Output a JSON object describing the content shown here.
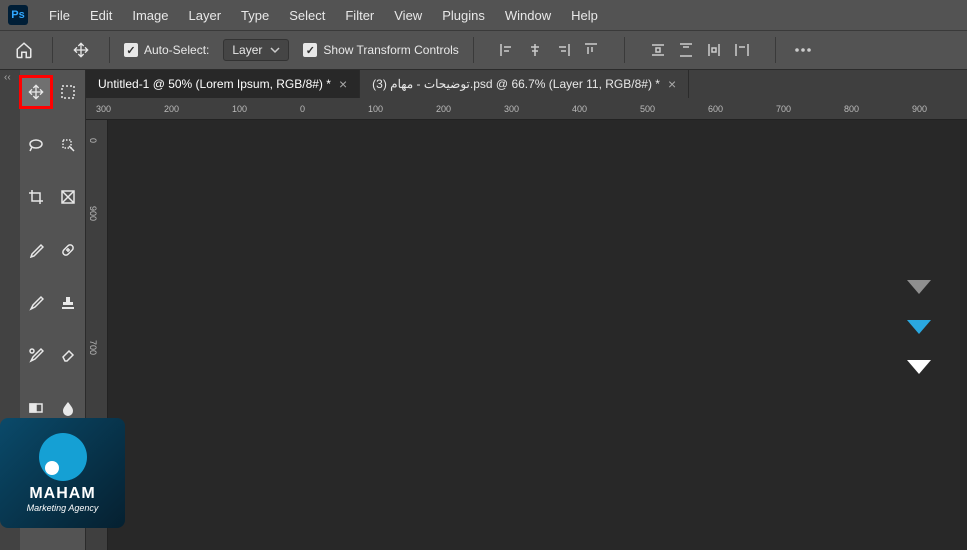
{
  "menubar": {
    "items": [
      "File",
      "Edit",
      "Image",
      "Layer",
      "Type",
      "Select",
      "Filter",
      "View",
      "Plugins",
      "Window",
      "Help"
    ]
  },
  "optbar": {
    "auto_select_label": "Auto-Select:",
    "layer_dd": "Layer",
    "show_transform_label": "Show Transform Controls"
  },
  "tabs": [
    {
      "label": "Untitled-1 @ 50% (Lorem Ipsum, RGB/8#) *",
      "active": true
    },
    {
      "label": "توضيحات - مهام (3).psd @ 66.7% (Layer 11, RGB/8#) *",
      "active": false
    }
  ],
  "ruler_h": [
    "300",
    "200",
    "100",
    "0",
    "100",
    "200",
    "300",
    "400",
    "500",
    "600",
    "700",
    "800",
    "900"
  ],
  "ruler_v": [
    "0",
    "900",
    "700"
  ],
  "overlay_logo": {
    "name": "MAHAM",
    "tagline": "Marketing Agency"
  }
}
